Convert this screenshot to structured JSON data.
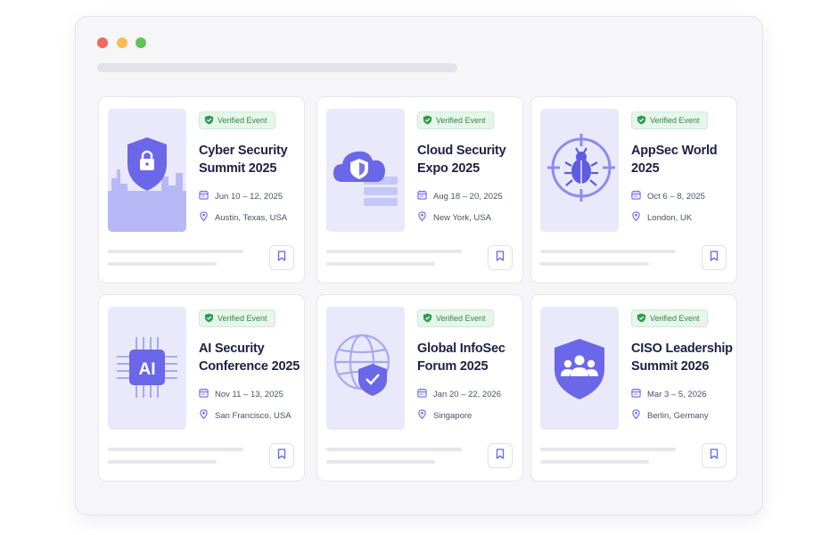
{
  "window": {
    "controls": {
      "close_color": "#ed6a5e",
      "minimize_color": "#f4bf4f",
      "maximize_color": "#61c554"
    }
  },
  "theme": {
    "accent": "#6366f1",
    "verified_green": "#2f8a48",
    "thumb_bg": "#e9e9fb"
  },
  "events": [
    {
      "badge": "Verified Event",
      "title": "Cyber Security Summit 2025",
      "date": "Jun 10 – 12, 2025",
      "location": "Austin, Texas, USA",
      "icon": "shield-lock-icon"
    },
    {
      "badge": "Verified Event",
      "title": "Cloud Security Expo 2025",
      "date": "Aug 18 – 20, 2025",
      "location": "New York, USA",
      "icon": "cloud-shield-icon"
    },
    {
      "badge": "Verified Event",
      "title": "AppSec World 2025",
      "date": "Oct 6 – 8, 2025",
      "location": "London, UK",
      "icon": "bug-target-icon"
    },
    {
      "badge": "Verified Event",
      "title": "AI Security Conference 2025",
      "date": "Nov 11 – 13, 2025",
      "location": "San Francisco, USA",
      "icon": "ai-chip-icon",
      "icon_text": "AI"
    },
    {
      "badge": "Verified Event",
      "title": "Global InfoSec Forum 2025",
      "date": "Jan 20 – 22, 2026",
      "location": "Singapore",
      "icon": "globe-shield-icon"
    },
    {
      "badge": "Verified Event",
      "title": "CISO Leadership Summit 2026",
      "date": "Mar 3 – 5, 2026",
      "location": "Berlin, Germany",
      "icon": "shield-team-icon"
    }
  ]
}
